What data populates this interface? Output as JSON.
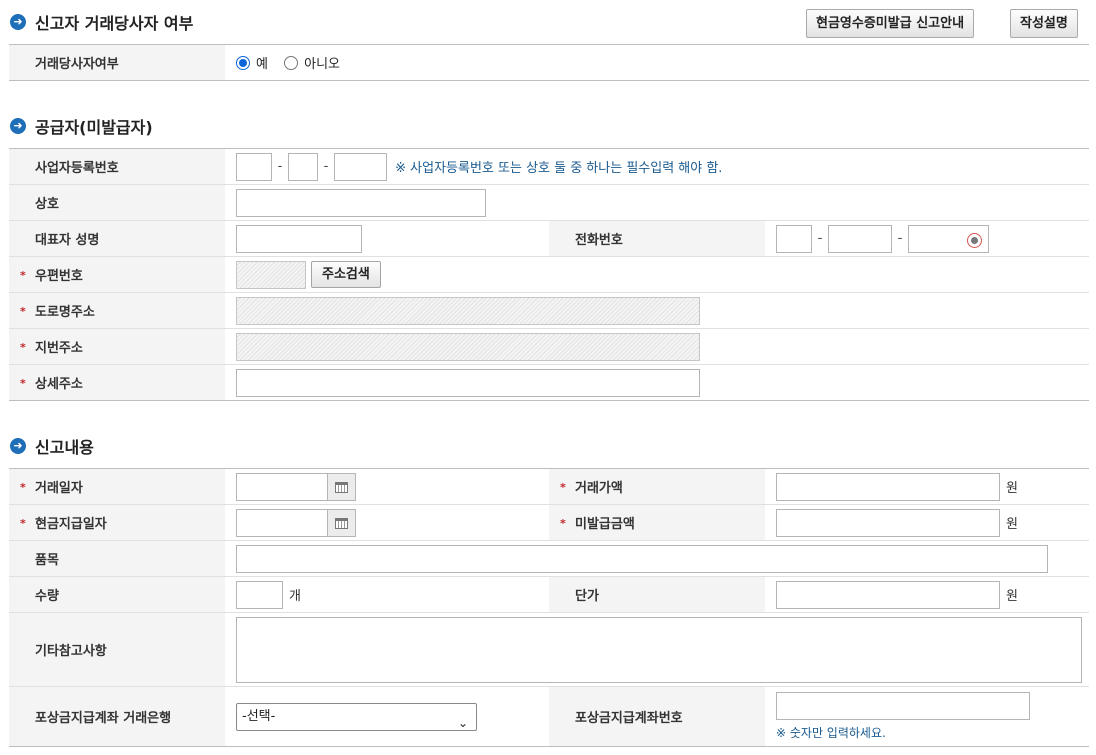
{
  "sections": {
    "s1": "신고자 거래당사자 여부",
    "s2": "공급자(미발급자)",
    "s3": "신고내용"
  },
  "top_buttons": {
    "guide": "현금영수증미발급 신고안내",
    "help": "작성설명"
  },
  "party": {
    "label": "거래당사자여부",
    "options": [
      "예",
      "아니오"
    ],
    "selected": "예"
  },
  "supplier": {
    "bizno_label": "사업자등록번호",
    "bizno_note": "※ 사업자등록번호 또는 상호 둘 중 하나는 필수입력 해야 함.",
    "name_label": "상호",
    "rep_label": "대표자 성명",
    "phone_label": "전화번호",
    "zip_label": "우편번호",
    "zip_button": "주소검색",
    "road_label": "도로명주소",
    "lot_label": "지번주소",
    "detail_label": "상세주소",
    "dash": "-"
  },
  "report": {
    "date_label": "거래일자",
    "amount_label": "거래가액",
    "paydate_label": "현금지급일자",
    "unissued_label": "미발급금액",
    "item_label": "품목",
    "qty_label": "수량",
    "qty_unit": "개",
    "price_label": "단가",
    "won": "원",
    "etc_label": "기타참고사항",
    "bank_label": "포상금지급계좌 거래은행",
    "bank_select": "-선택-",
    "account_label": "포상금지급계좌번호",
    "account_note": "※ 숫자만 입력하세요."
  },
  "required_mark": "*",
  "colors": {
    "accent": "#1f6fb8",
    "required": "#c0282d",
    "note": "#1a5a8f",
    "header_bg": "#f4f4f4"
  }
}
